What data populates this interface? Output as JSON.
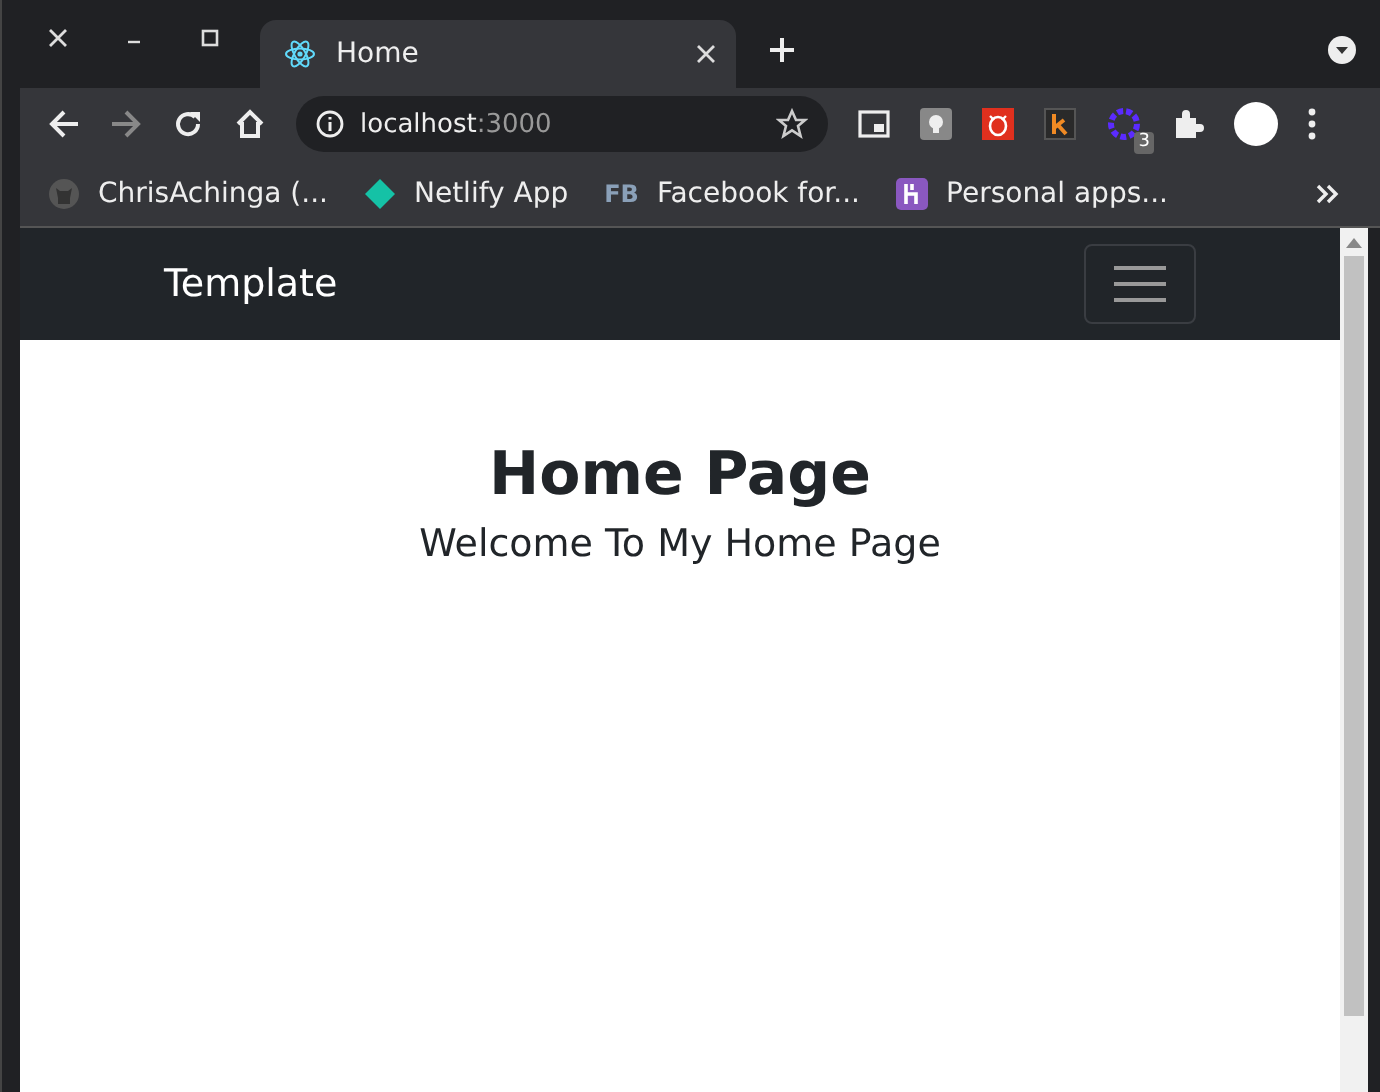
{
  "tab": {
    "title": "Home",
    "selected": true
  },
  "address": {
    "host": "localhost",
    "port": ":3000"
  },
  "extension_badge": "3",
  "bookmarks": [
    {
      "kind": "github",
      "label": "ChrisAchinga (..."
    },
    {
      "kind": "netlify",
      "label": "Netlify App"
    },
    {
      "kind": "text",
      "icon_text": "FB",
      "label": "Facebook for..."
    },
    {
      "kind": "heroku",
      "label": "Personal apps..."
    }
  ],
  "navbar": {
    "brand": "Template"
  },
  "page": {
    "heading": "Home Page",
    "subtitle": "Welcome To My Home Page"
  }
}
